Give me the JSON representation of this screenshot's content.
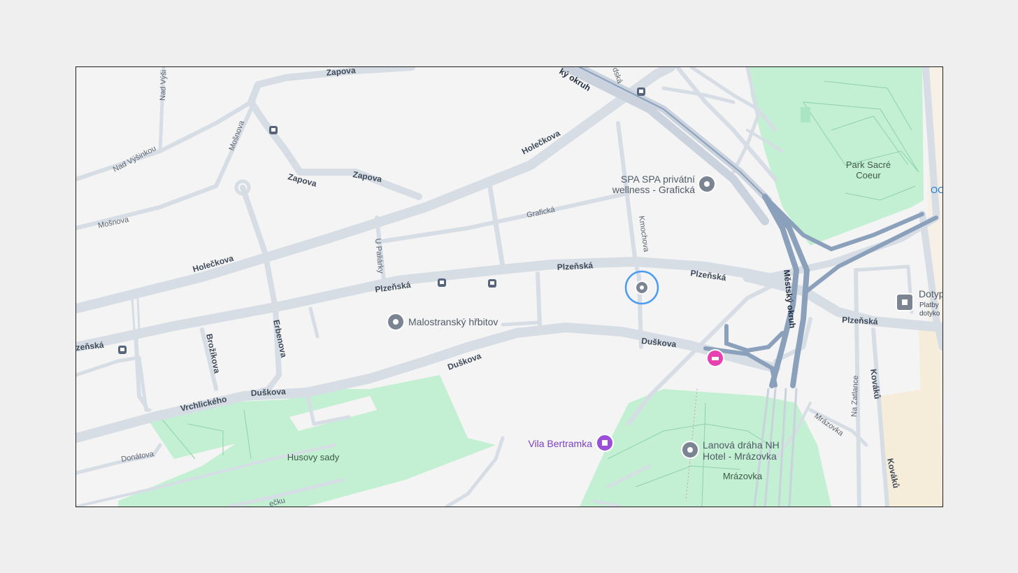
{
  "map": {
    "streets": {
      "zapova_top": "Zapova",
      "zapova_1": "Zapova",
      "zapova_2": "Zapova",
      "nad_vysinou_1": "Nad Výši",
      "nad_vysinou_2": "Nad Výšinkou",
      "mosnova_1": "Mošnova",
      "mosnova_2": "Mošnova",
      "holeckova_1": "Holečkova",
      "holeckova_2": "Holečkova",
      "graficka": "Grafická",
      "u_palirky": "U Paliárky",
      "kmochova": "Kmochova",
      "plzenska_1": "Plzeňská",
      "plzenska_2": "Plzeňská",
      "plzenska_3": "Plzeňská",
      "plzenska_4": "Plzeňská",
      "plzenska_left": "zeňská",
      "mestsky_okruh_top": "ký okruh",
      "mestsky_okruh": "Městský okruh",
      "duskova_1": "Duškova",
      "duskova_2": "Duškova",
      "duskova_3": "Duškova",
      "erbenova": "Erbenova",
      "brozikova": "Brožíkova",
      "vrchlickeho": "Vrchlického",
      "donatova": "Donátova",
      "duskova_bottom": "ečku",
      "mrazovka": "Mrázovka",
      "na_zatlance": "Na Zatlance",
      "kovaku_1": "Kováků",
      "kovaku_2": "Kováků",
      "top_dska": "dská"
    },
    "pois": {
      "spa_line1": "SPA SPA privátní",
      "spa_line2": "wellness - Grafická",
      "malostransky": "Malostranský hřbitov",
      "vila_bertramka": "Vila Bertramka",
      "lanova_line1": "Lanová dráha NH",
      "lanova_line2": "Hotel - Mrázovka",
      "dotyp_1": "Dotyp",
      "dotyp_2": "Platby",
      "dotyp_3": "dotyko",
      "oc": "OC"
    },
    "parks": {
      "park_sacre_1": "Park Sacré",
      "park_sacre_2": "Coeur",
      "husovy_sady": "Husovy sady",
      "mrazovka_park": "Mrázovka"
    },
    "colors": {
      "background": "#f5f4f4",
      "road": "#d6dde5",
      "highway": "#8aa0bb",
      "park": "#c3f0d3",
      "poi_gray": "#7b8591",
      "hotel_pink": "#e840b0",
      "museum_purple": "#9b4fd9",
      "selection_blue": "#4a9bf2"
    },
    "icons": [
      "tram-stop-icon",
      "pin-icon",
      "hotel-icon",
      "museum-icon",
      "selected-location-icon"
    ]
  }
}
